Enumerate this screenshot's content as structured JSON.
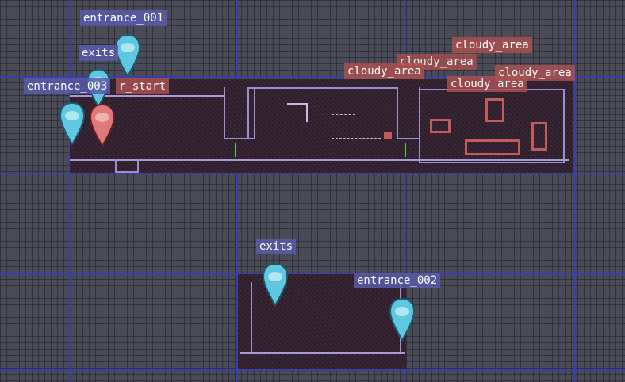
{
  "labels": {
    "entrance_001": "entrance_001",
    "exits_top": "exits",
    "entrance_003": "entrance_003",
    "player_start": "r_start",
    "cloudy_1": "cloudy_area",
    "cloudy_2": "cloudy_area",
    "cloudy_3": "cloudy_area",
    "cloudy_4": "cloudy_area",
    "cloudy_5": "cloudy_area",
    "exits_bottom": "exits",
    "entrance_002": "entrance_002"
  },
  "colors": {
    "entrance_marker": "#5fc8e0",
    "start_marker": "#e07a7a",
    "grid_major": "#3a3ea8",
    "cloudy_region": "#c25c5c"
  },
  "icons": [
    "map-pin-icon"
  ]
}
